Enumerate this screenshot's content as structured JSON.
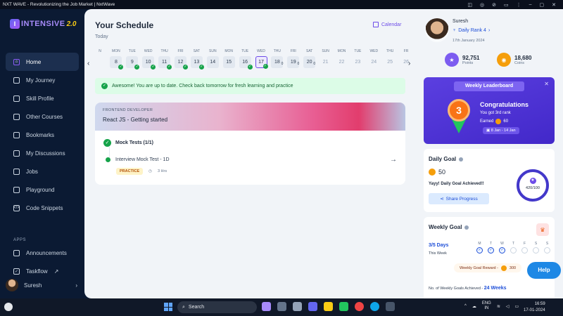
{
  "window": {
    "title": "NXT WAVE - Revolutionizing the Job Market | NxtWave"
  },
  "logo": {
    "mark": "I",
    "text": "INTENSIVE",
    "version": "2.0"
  },
  "sidebar": {
    "items": [
      {
        "label": "Home",
        "icon": "home-icon"
      },
      {
        "label": "My Journey",
        "icon": "journey-icon"
      },
      {
        "label": "Skill Profile",
        "icon": "skill-profile-icon"
      },
      {
        "label": "Other Courses",
        "icon": "courses-icon"
      },
      {
        "label": "Bookmarks",
        "icon": "bookmark-icon"
      },
      {
        "label": "My Discussions",
        "icon": "discussions-icon"
      },
      {
        "label": "Jobs",
        "icon": "jobs-icon"
      },
      {
        "label": "Playground",
        "icon": "playground-icon"
      },
      {
        "label": "Code Snippets",
        "icon": "code-icon"
      }
    ],
    "apps_label": "APPS",
    "apps": [
      {
        "label": "Announcements",
        "icon": "bell-icon"
      },
      {
        "label": "Taskflow",
        "icon": "check-square-icon"
      }
    ],
    "user": {
      "name": "Suresh"
    }
  },
  "schedule": {
    "title": "Your Schedule",
    "subtitle": "Today",
    "calendar_label": "Calendar",
    "days": [
      {
        "name": "N",
        "date": "",
        "state": "empty"
      },
      {
        "name": "MON",
        "date": "8",
        "state": "done"
      },
      {
        "name": "TUE",
        "date": "9",
        "state": "done"
      },
      {
        "name": "WED",
        "date": "10",
        "state": "done"
      },
      {
        "name": "THU",
        "date": "11",
        "state": "done"
      },
      {
        "name": "FRI",
        "date": "12",
        "state": "done"
      },
      {
        "name": "SAT",
        "date": "13",
        "state": "done"
      },
      {
        "name": "SUN",
        "date": "14",
        "state": "plain"
      },
      {
        "name": "MON",
        "date": "15",
        "state": "plain"
      },
      {
        "name": "TUE",
        "date": "16",
        "state": "done"
      },
      {
        "name": "WED",
        "date": "17",
        "state": "selected"
      },
      {
        "name": "THU",
        "date": "18",
        "state": "zero"
      },
      {
        "name": "FRI",
        "date": "19",
        "state": "zero"
      },
      {
        "name": "SAT",
        "date": "20",
        "state": "zero"
      },
      {
        "name": "SUN",
        "date": "21",
        "state": "future"
      },
      {
        "name": "MON",
        "date": "22",
        "state": "future"
      },
      {
        "name": "TUE",
        "date": "23",
        "state": "future"
      },
      {
        "name": "WED",
        "date": "24",
        "state": "future"
      },
      {
        "name": "THU",
        "date": "25",
        "state": "future"
      },
      {
        "name": "FR",
        "date": "26",
        "state": "future"
      }
    ],
    "zero_mark": "0",
    "banner": "Awesome! You are up to date. Check back tomorrow for fresh learning and practice"
  },
  "course": {
    "tag": "FRONTEND DEVELOPER",
    "name": "React JS - Getting started",
    "section_title": "Mock Tests (1/1)",
    "item_title": "Interview Mock Test - 1D",
    "item_type": "PRACTICE",
    "duration": "3 Hrs"
  },
  "profile": {
    "name": "Suresh",
    "rank": "Daily Rank 4",
    "date": "17th January 2024",
    "points_value": "92,751",
    "points_label": "Points",
    "coins_value": "18,680",
    "coins_label": "Coins"
  },
  "leaderboard": {
    "title": "Weekly Leaderboard",
    "rank_number": "3",
    "heading": "Congratulations",
    "subtitle": "You got 3rd rank",
    "earned_label": "Earned",
    "earned_value": "60",
    "range": "8 Jan - 14 Jan"
  },
  "daily_goal": {
    "title": "Daily Goal",
    "value": "50",
    "message": "Yayy! Daily Goal Achieved!!",
    "share_label": "Share Progress",
    "progress_text": "420/100"
  },
  "weekly_goal": {
    "title": "Weekly Goal",
    "days_value": "3/5 Days",
    "this_week": "This Week",
    "days": [
      {
        "label": "M",
        "done": true
      },
      {
        "label": "T",
        "done": true
      },
      {
        "label": "W",
        "done": true
      },
      {
        "label": "T",
        "done": false
      },
      {
        "label": "F",
        "done": false
      },
      {
        "label": "S",
        "done": false
      },
      {
        "label": "S",
        "done": false
      }
    ],
    "check_mark": "✓",
    "reward_label": "Weekly Goal Reward -",
    "reward_value": "300",
    "achieved_label": "No. of Weekly Goals Achieved -",
    "achieved_value": "24 Weeks"
  },
  "help": {
    "label": "Help"
  },
  "taskbar": {
    "search_label": "Search",
    "lang_line1": "ENG",
    "lang_line2": "IN",
    "time": "16:59",
    "date": "17-01-2024"
  },
  "colors": {
    "accent": "#6d4ce8",
    "success": "#16a34a",
    "link": "#1d4ed8",
    "sidebar_bg": "#0b1a33"
  }
}
